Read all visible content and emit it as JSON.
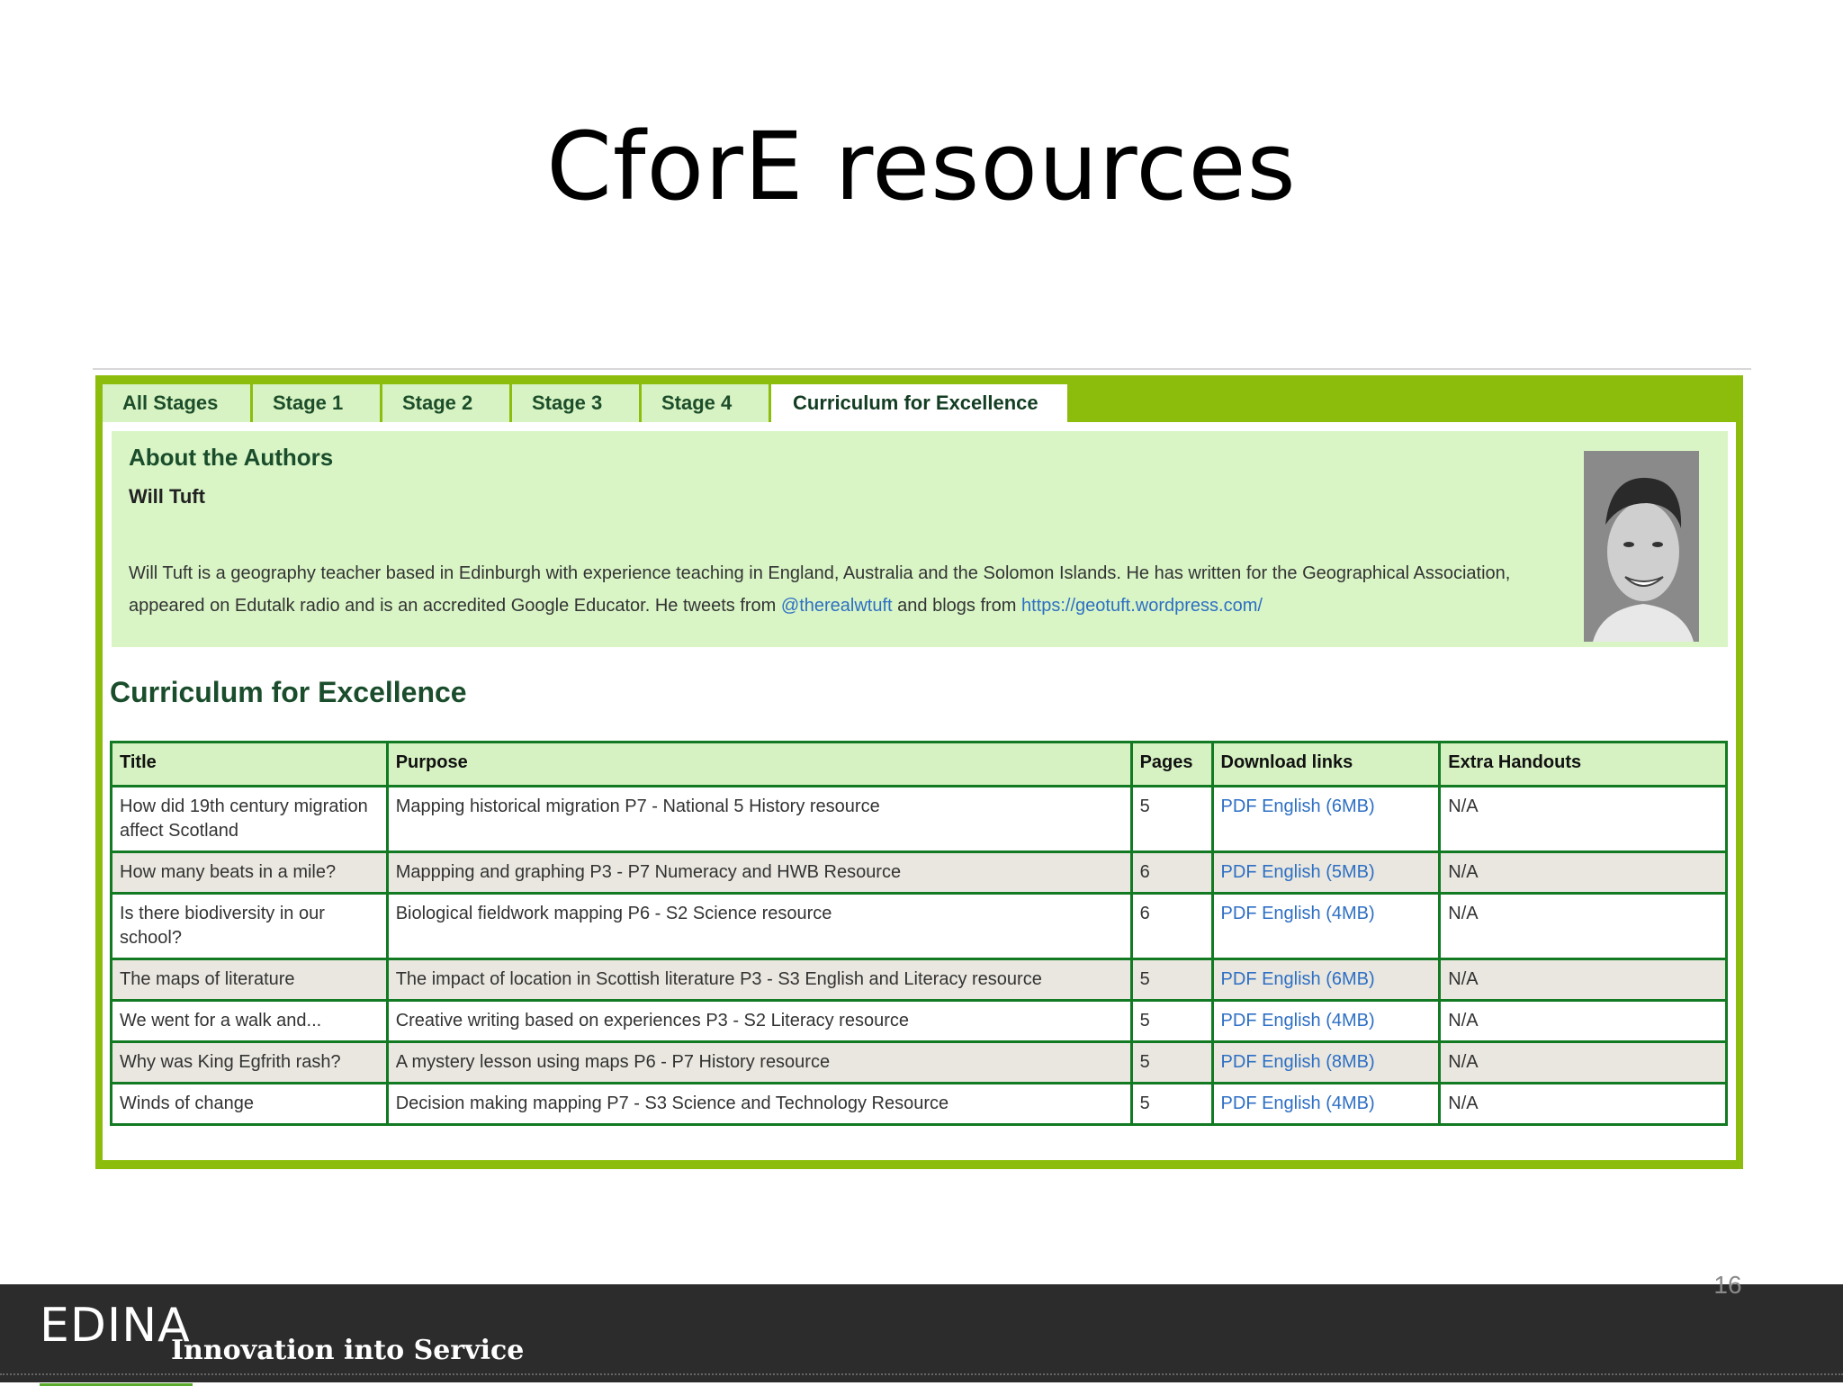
{
  "slide": {
    "title": "CforE resources",
    "number": "16"
  },
  "tabs": [
    {
      "label": "All Stages",
      "active": false
    },
    {
      "label": "Stage 1",
      "active": false
    },
    {
      "label": "Stage 2",
      "active": false
    },
    {
      "label": "Stage 3",
      "active": false
    },
    {
      "label": "Stage 4",
      "active": false
    },
    {
      "label": "Curriculum for Excellence",
      "active": true
    }
  ],
  "authors": {
    "heading": "About the Authors",
    "name": "Will Tuft",
    "bio_part1": "Will Tuft is a geography teacher based in Edinburgh with experience teaching in England, Australia and the Solomon Islands. He has written for the Geographical Association, appeared on Edutalk radio and is an accredited Google Educator. He tweets from ",
    "twitter": "@therealwtuft",
    "bio_part2": " and blogs from ",
    "blog": "https://geotuft.wordpress.com/"
  },
  "section": {
    "heading": "Curriculum for Excellence"
  },
  "table": {
    "headers": [
      "Title",
      "Purpose",
      "Pages",
      "Download links",
      "Extra Handouts"
    ],
    "rows": [
      {
        "title": "How did 19th century migration affect Scotland",
        "purpose": "Mapping historical migration P7 - National 5 History resource",
        "pages": "5",
        "download": "PDF English (6MB)",
        "extra": "N/A"
      },
      {
        "title": "How many beats in a mile?",
        "purpose": "Mappping and graphing P3 - P7 Numeracy and HWB Resource",
        "pages": "6",
        "download": "PDF English (5MB)",
        "extra": "N/A"
      },
      {
        "title": "Is there biodiversity in our school?",
        "purpose": "Biological fieldwork mapping P6 - S2 Science resource",
        "pages": "6",
        "download": "PDF English (4MB)",
        "extra": "N/A"
      },
      {
        "title": "The maps of literature",
        "purpose": "The impact of location in Scottish literature P3 - S3 English and Literacy resource",
        "pages": "5",
        "download": "PDF English (6MB)",
        "extra": "N/A"
      },
      {
        "title": "We went for a walk and...",
        "purpose": "Creative writing based on experiences P3 - S2 Literacy resource",
        "pages": "5",
        "download": "PDF English (4MB)",
        "extra": "N/A"
      },
      {
        "title": "Why was King Egfrith rash?",
        "purpose": "A mystery lesson using maps P6 - P7 History resource",
        "pages": "5",
        "download": "PDF English (8MB)",
        "extra": "N/A"
      },
      {
        "title": "Winds of change",
        "purpose": "Decision making mapping P7 - S3 Science and Technology Resource",
        "pages": "5",
        "download": "PDF English (4MB)",
        "extra": "N/A"
      }
    ]
  },
  "footer": {
    "logo_text": "EDINA",
    "tagline": "Innovation into Service"
  },
  "colors": {
    "frame": "#8cbd0c",
    "tab": "#d7f3c3",
    "panel": "#d9f5c6",
    "table_border": "#127a22",
    "link": "#2e6fc4",
    "heading": "#1a4d2b",
    "footer": "#2c2c2c"
  }
}
